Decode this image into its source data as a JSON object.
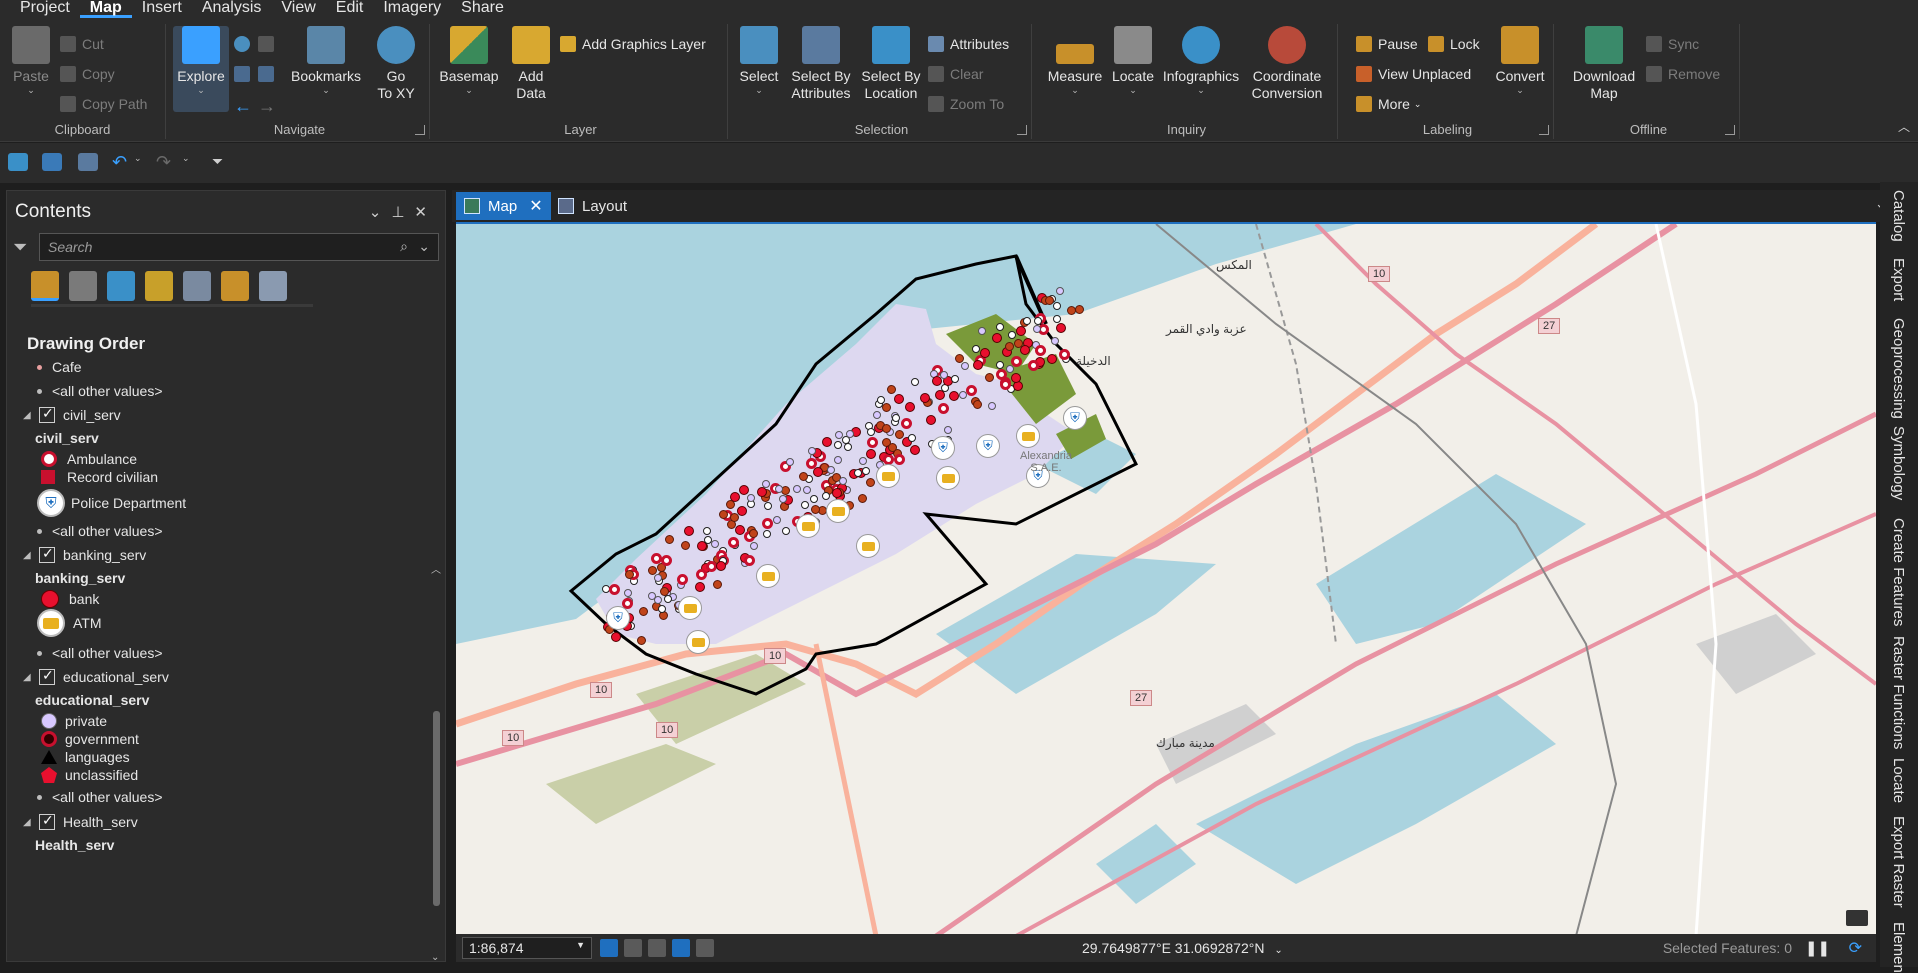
{
  "menu": {
    "tabs": [
      "Project",
      "Map",
      "Insert",
      "Analysis",
      "View",
      "Edit",
      "Imagery",
      "Share"
    ],
    "active": "Map"
  },
  "ribbon": {
    "clipboard": {
      "label": "Clipboard",
      "paste": "Paste",
      "cut": "Cut",
      "copy": "Copy",
      "copy_path": "Copy Path"
    },
    "navigate": {
      "label": "Navigate",
      "explore": "Explore",
      "bookmarks": "Bookmarks",
      "go_to_xy_1": "Go",
      "go_to_xy_2": "To XY"
    },
    "layer": {
      "label": "Layer",
      "basemap": "Basemap",
      "add_data_1": "Add",
      "add_data_2": "Data",
      "add_graphics_layer": "Add Graphics Layer"
    },
    "selection": {
      "label": "Selection",
      "select": "Select",
      "select_by_attributes_1": "Select By",
      "select_by_attributes_2": "Attributes",
      "select_by_location_1": "Select By",
      "select_by_location_2": "Location",
      "attributes": "Attributes",
      "clear": "Clear",
      "zoom_to": "Zoom To"
    },
    "inquiry": {
      "label": "Inquiry",
      "measure": "Measure",
      "locate": "Locate",
      "infographics": "Infographics",
      "coord_conv_1": "Coordinate",
      "coord_conv_2": "Conversion"
    },
    "labeling": {
      "label": "Labeling",
      "pause": "Pause",
      "lock": "Lock",
      "view_unplaced": "View Unplaced",
      "more": "More",
      "convert": "Convert"
    },
    "offline": {
      "label": "Offline",
      "download_1": "Download",
      "download_2": "Map",
      "sync": "Sync",
      "remove": "Remove"
    }
  },
  "contents": {
    "title": "Contents",
    "search_placeholder": "Search",
    "drawing_order": "Drawing Order",
    "items": {
      "cafe": "Cafe",
      "other1": "<all other values>",
      "civil_layer": "civil_serv",
      "civil_field": "civil_serv",
      "ambulance": "Ambulance",
      "record_civilian": "Record civilian",
      "police": "Police Department",
      "other2": "<all other values>",
      "banking_layer": "banking_serv",
      "banking_field": "banking_serv",
      "bank": "bank",
      "atm": "ATM",
      "other3": "<all other values>",
      "edu_layer": "educational_serv",
      "edu_field": "educational_serv",
      "private": "private",
      "government": "government",
      "languages": "languages",
      "unclassified": "unclassified",
      "other4": "<all other values>",
      "health_layer": "Health_serv",
      "health_field": "Health_serv"
    }
  },
  "map_view": {
    "tabs": {
      "map": "Map",
      "layout": "Layout"
    },
    "labels": {
      "city1": "المكس",
      "city2": "عزبة وادي القمر",
      "city3": "الدخيلة",
      "city4": "مدينة مبارك",
      "poi": "Alexandria S.A.E.",
      "road10a": "10",
      "road10b": "10",
      "road10c": "10",
      "road10d": "10",
      "road10e": "10",
      "road27a": "27",
      "road27b": "27"
    }
  },
  "status": {
    "scale": "1:86,874",
    "coordinates": "29.7649877°E 31.0692872°N",
    "selected_features": "Selected Features: 0"
  },
  "dock": [
    "Catalog",
    "Export",
    "Geoprocessing",
    "Symbology",
    "Create Features",
    "Raster Functions",
    "Locate",
    "Export Raster",
    "Elemen"
  ],
  "colors": {
    "water": "#aad3df",
    "land": "#f2efe9",
    "accent": "#1f6fbf",
    "road_primary": "#e892a2",
    "road_trunk": "#f9b29c",
    "poi_red": "#c8102e"
  }
}
